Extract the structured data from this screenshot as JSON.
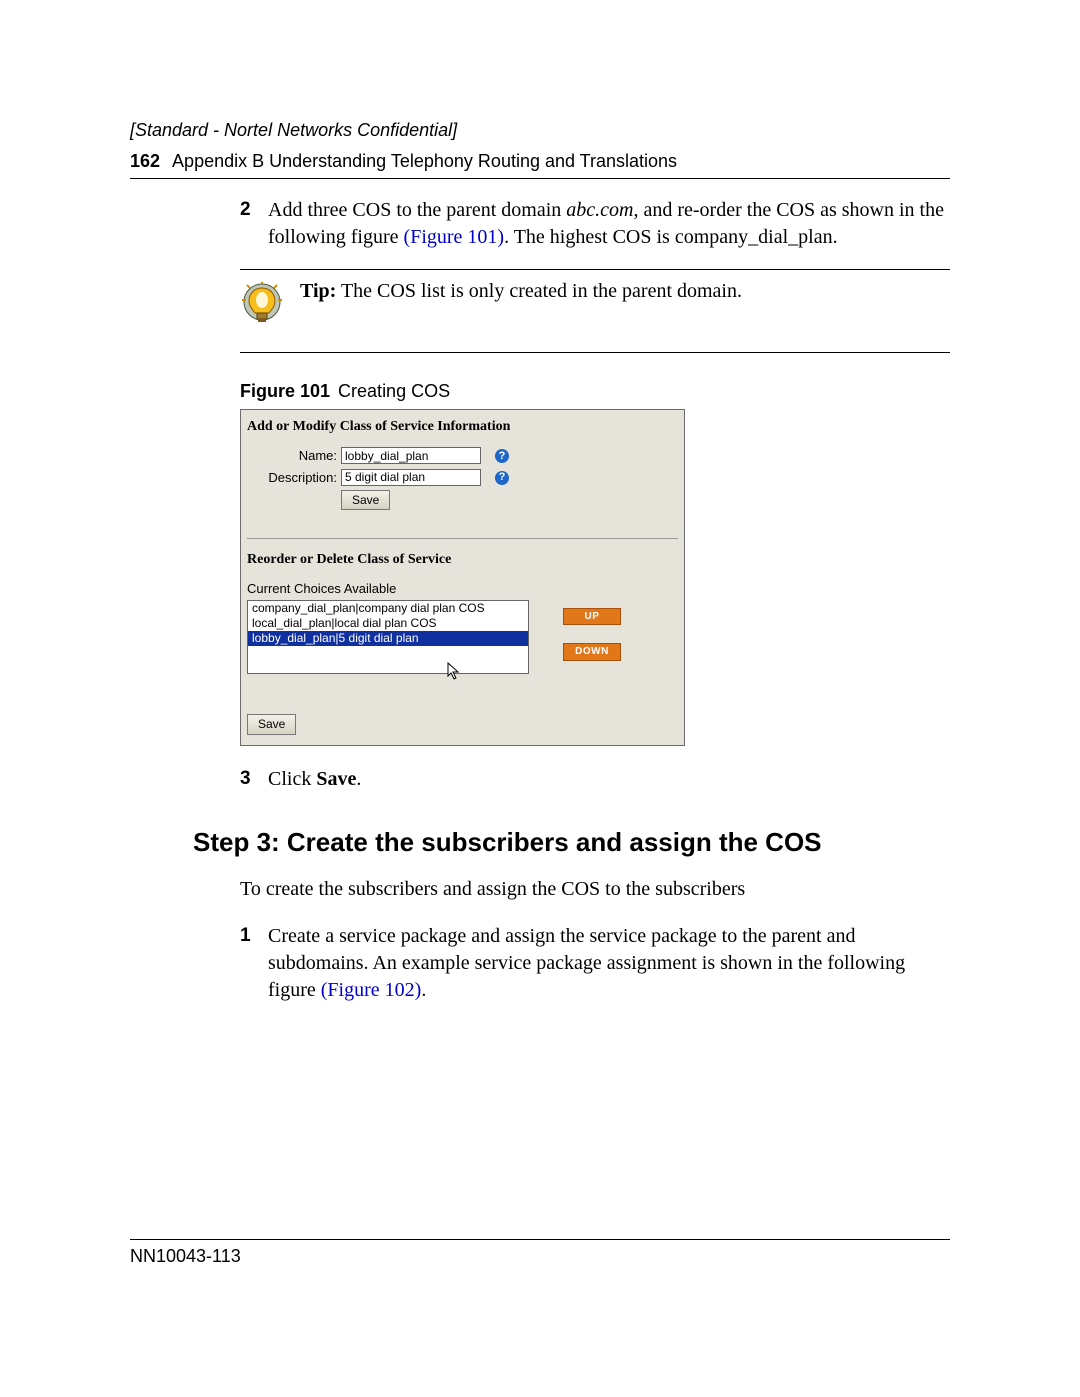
{
  "header": {
    "confidential": "[Standard - Nortel Networks Confidential]",
    "page_num": "162",
    "appendix": "Appendix B  Understanding Telephony Routing and Translations"
  },
  "body": {
    "step2_num": "2",
    "step2_a": "Add three COS to the parent domain ",
    "step2_domain": "abc.com",
    "step2_b": ", and re-order the COS as shown in the following figure ",
    "step2_figref": "(Figure 101)",
    "step2_c": ". The highest COS is company_dial_plan.",
    "tip_label": "Tip:",
    "tip_text": " The COS list is only created in the parent domain.",
    "fig_label": "Figure 101",
    "fig_caption": "Creating COS",
    "step3_num": "3",
    "step3_a": "Click ",
    "step3_b": "Save",
    "step3_c": ".",
    "h2": "Step 3: Create the subscribers and assign the COS",
    "para": "To create the subscribers and assign the COS to the subscribers",
    "sub1_num": "1",
    "sub1_a": "Create a service package and assign the service package to the parent and subdomains. An example service package assignment is shown in the following figure ",
    "sub1_figref": "(Figure 102)",
    "sub1_b": "."
  },
  "figure": {
    "section1_title": "Add or Modify Class of Service Information",
    "name_label": "Name:",
    "name_value": "lobby_dial_plan",
    "desc_label": "Description:",
    "desc_value": "5 digit dial plan",
    "save_btn": "Save",
    "section2_title": "Reorder or Delete Class of Service",
    "choices_label": "Current Choices Available",
    "options": [
      "company_dial_plan|company dial plan COS",
      "local_dial_plan|local dial plan COS",
      "lobby_dial_plan|5 digit dial plan"
    ],
    "up_btn": "UP",
    "down_btn": "DOWN",
    "save2_btn": "Save"
  },
  "footer": {
    "docid": "NN10043-113"
  }
}
